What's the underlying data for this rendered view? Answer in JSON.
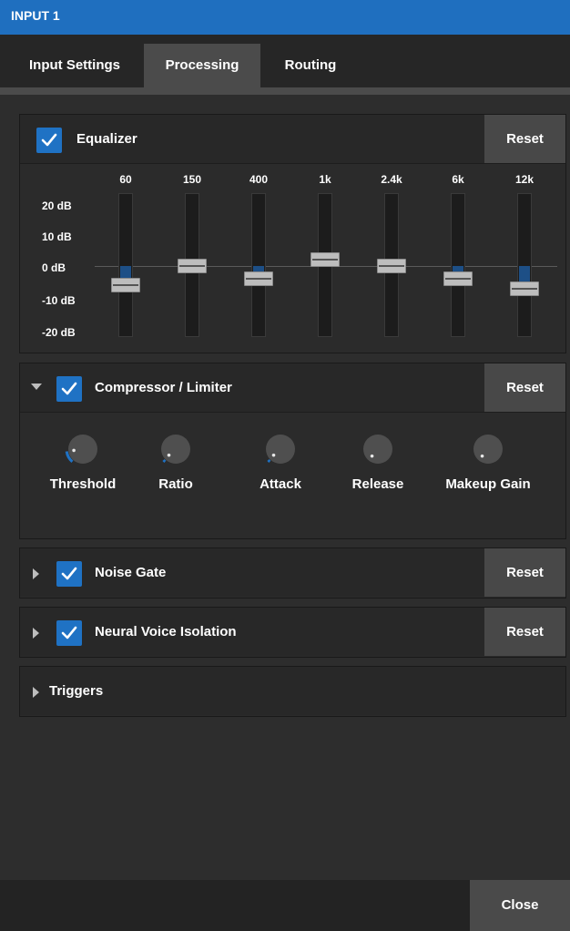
{
  "window": {
    "title": "INPUT 1"
  },
  "tabs": [
    {
      "label": "Input Settings",
      "active": false
    },
    {
      "label": "Processing",
      "active": true
    },
    {
      "label": "Routing",
      "active": false
    }
  ],
  "equalizer": {
    "label": "Equalizer",
    "enabled": true,
    "reset_label": "Reset",
    "db_labels": [
      "20 dB",
      "10 dB",
      "0 dB",
      "-10 dB",
      "-20 dB"
    ],
    "bands": [
      {
        "freq": "60",
        "gain_db": -6
      },
      {
        "freq": "150",
        "gain_db": 0
      },
      {
        "freq": "400",
        "gain_db": -4
      },
      {
        "freq": "1k",
        "gain_db": 2
      },
      {
        "freq": "2.4k",
        "gain_db": 0
      },
      {
        "freq": "6k",
        "gain_db": -4
      },
      {
        "freq": "12k",
        "gain_db": -7
      }
    ]
  },
  "compressor": {
    "label": "Compressor / Limiter",
    "enabled": true,
    "expanded": true,
    "reset_label": "Reset",
    "knobs": [
      {
        "label": "Threshold",
        "level": 0.15
      },
      {
        "label": "Ratio",
        "level": 0.03
      },
      {
        "label": "Attack",
        "level": 0.03
      },
      {
        "label": "Release",
        "level": 0
      },
      {
        "label": "Makeup Gain",
        "level": 0
      }
    ]
  },
  "noise_gate": {
    "label": "Noise Gate",
    "enabled": true,
    "expanded": false,
    "reset_label": "Reset"
  },
  "voice_isolation": {
    "label": "Neural Voice Isolation",
    "enabled": true,
    "expanded": false,
    "reset_label": "Reset"
  },
  "triggers": {
    "label": "Triggers",
    "expanded": false
  },
  "footer": {
    "close_label": "Close"
  },
  "colors": {
    "accent": "#1f72c4",
    "titlebar": "#1f6fbf",
    "eq_fill": "#1d4f86"
  }
}
